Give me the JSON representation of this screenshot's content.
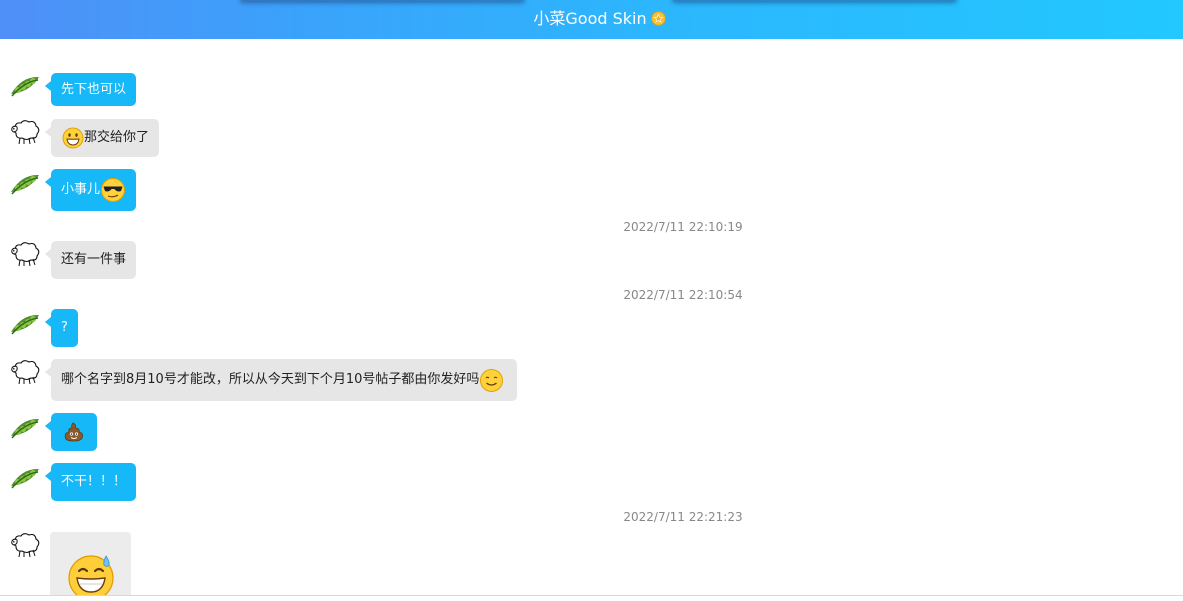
{
  "header": {
    "title": "小菜Good Skin",
    "accent_start": "#4f8ff7",
    "accent_end": "#22c8ff",
    "badge_icon": "star-badge-icon"
  },
  "colors": {
    "my_bubble": "#17b8f8",
    "other_bubble": "#e6e6e6",
    "timestamp": "#888888"
  },
  "messages": [
    {
      "from": "me",
      "text": "先下也可以",
      "avatar": "pea-pod-avatar"
    },
    {
      "from": "other",
      "text": "那交给你了",
      "emoji_before": "grinning-face-icon",
      "avatar": "sheep-sketch-avatar"
    },
    {
      "from": "me",
      "text": "小事儿",
      "emoji_after": "cool-sunglasses-face-icon",
      "avatar": "pea-pod-avatar"
    },
    {
      "timestamp": "2022/7/11 22:10:19"
    },
    {
      "from": "other",
      "text": "还有一件事",
      "avatar": "sheep-sketch-avatar"
    },
    {
      "timestamp": "2022/7/11 22:10:54"
    },
    {
      "from": "me",
      "text": "?",
      "avatar": "pea-pod-avatar"
    },
    {
      "from": "other",
      "text": "哪个名字到8月10号才能改，所以从今天到下个月10号帖子都由你发好吗",
      "emoji_after": "smiling-face-icon",
      "avatar": "sheep-sketch-avatar"
    },
    {
      "from": "me",
      "emoji": "pile-of-poo-icon",
      "avatar": "pea-pod-avatar"
    },
    {
      "from": "me",
      "text": "不干！！！",
      "avatar": "pea-pod-avatar"
    },
    {
      "timestamp": "2022/7/11 22:21:23"
    },
    {
      "from": "other",
      "image": "grinning-sweat-sticker",
      "avatar": "sheep-sketch-avatar"
    }
  ]
}
